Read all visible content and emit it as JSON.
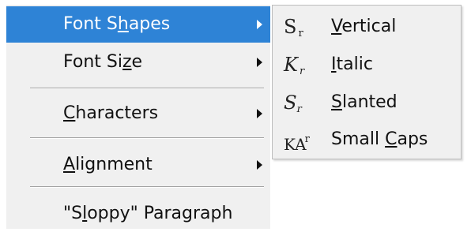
{
  "menu": {
    "items": [
      {
        "pre": "Font S",
        "ul": "h",
        "post": "apes",
        "has_submenu": true,
        "selected": true
      },
      {
        "pre": "Font Si",
        "ul": "z",
        "post": "e",
        "has_submenu": true
      },
      {
        "pre": "",
        "ul": "C",
        "post": "haracters",
        "has_submenu": true
      },
      {
        "pre": "",
        "ul": "A",
        "post": "lignment",
        "has_submenu": true
      },
      {
        "pre": "\"S",
        "ul": "l",
        "post": "oppy\" Paragraph",
        "has_submenu": false
      }
    ]
  },
  "submenu": {
    "items": [
      {
        "icon": "S",
        "icon_mark": "r",
        "icon_name": "vertical-shape-icon",
        "pre": "",
        "ul": "V",
        "post": "ertical"
      },
      {
        "icon": "K",
        "icon_mark": "r",
        "icon_name": "italic-shape-icon",
        "pre": "",
        "ul": "I",
        "post": "talic"
      },
      {
        "icon": "S",
        "icon_mark": "r",
        "icon_name": "slanted-shape-icon",
        "pre": "",
        "ul": "S",
        "post": "lanted"
      },
      {
        "icon": "KA",
        "icon_mark": "r",
        "icon_name": "small-caps-icon",
        "pre": "Small ",
        "ul": "C",
        "post": "aps"
      }
    ]
  },
  "colors": {
    "selection": "#2e83d6",
    "menu_bg": "#f0f0f0"
  }
}
